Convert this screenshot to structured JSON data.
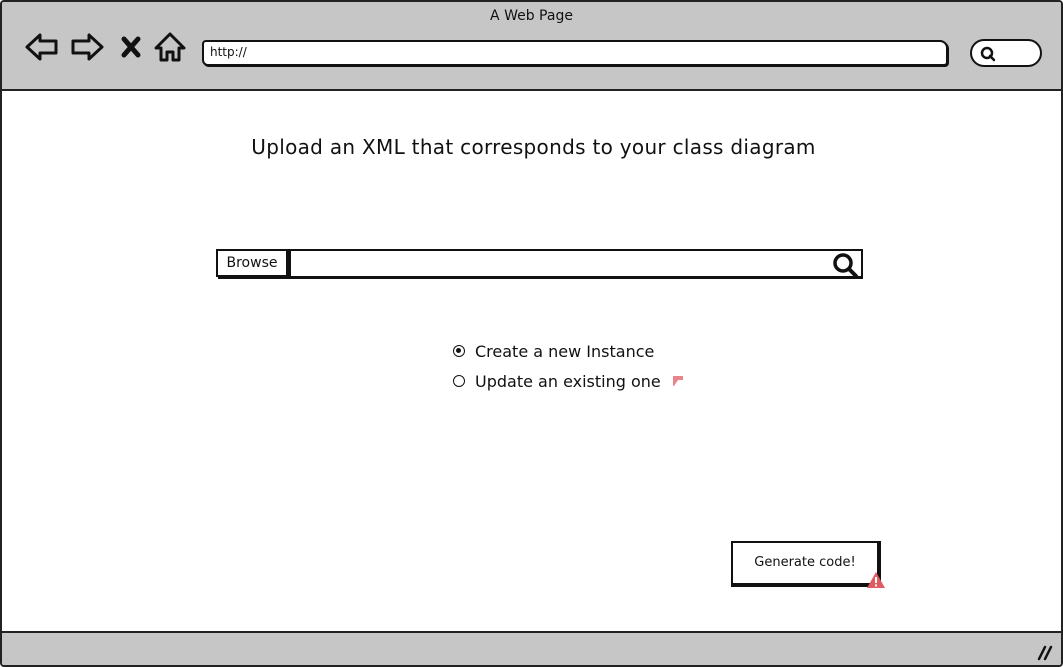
{
  "window": {
    "title": "A Web Page"
  },
  "toolbar": {
    "back_icon": "back-arrow-icon",
    "forward_icon": "forward-arrow-icon",
    "stop_icon": "stop-x-icon",
    "home_icon": "home-icon",
    "address": "http://",
    "search_icon": "search-icon"
  },
  "main": {
    "heading": "Upload an XML that corresponds to your class diagram",
    "browse_label": "Browse",
    "file_value": "",
    "radio_options": [
      {
        "label": "Create a new Instance",
        "checked": true
      },
      {
        "label": "Update an existing one",
        "checked": false
      }
    ],
    "generate_label": "Generate code!"
  },
  "colors": {
    "chrome_gray": "#c6c6c6",
    "ink": "#111111",
    "note_red": "#e8848a",
    "warning_red": "#e05c60"
  }
}
